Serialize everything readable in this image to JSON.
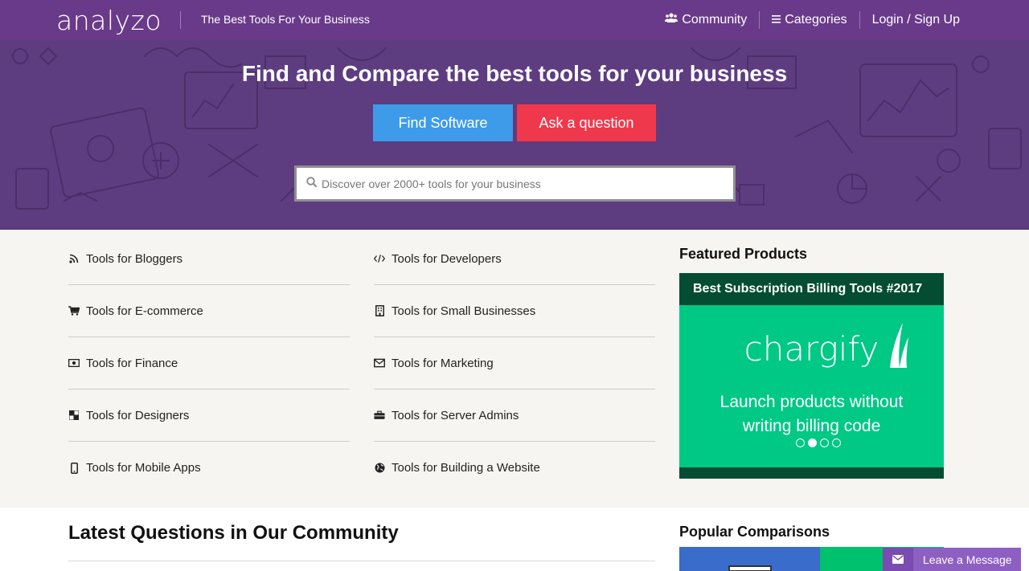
{
  "header": {
    "logo": "analyzo",
    "tagline": "The Best Tools For Your Business",
    "nav": [
      {
        "label": "Community",
        "icon": "users-icon"
      },
      {
        "label": "Categories",
        "icon": "menu-icon"
      },
      {
        "label": "Login / Sign Up"
      }
    ]
  },
  "hero": {
    "title": "Find and Compare the best tools for your business",
    "find_button": "Find Software",
    "ask_button": "Ask a question",
    "search_placeholder": "Discover over 2000+ tools for your business"
  },
  "categories": {
    "left": [
      {
        "label": "Tools for Bloggers",
        "icon": "rss-icon"
      },
      {
        "label": "Tools for E-commerce",
        "icon": "cart-icon"
      },
      {
        "label": "Tools for Finance",
        "icon": "money-icon"
      },
      {
        "label": "Tools for Designers",
        "icon": "palette-icon"
      },
      {
        "label": "Tools for Mobile Apps",
        "icon": "mobile-icon"
      }
    ],
    "right": [
      {
        "label": "Tools for Developers",
        "icon": "code-icon"
      },
      {
        "label": "Tools for Small Businesses",
        "icon": "building-icon"
      },
      {
        "label": "Tools for Marketing",
        "icon": "envelope-icon"
      },
      {
        "label": "Tools for Server Admins",
        "icon": "briefcase-icon"
      },
      {
        "label": "Tools for Building a Website",
        "icon": "globe-icon"
      }
    ]
  },
  "featured": {
    "title": "Featured Products",
    "card_heading": "Best Subscription Billing Tools #2017",
    "brand": "chargify",
    "tagline": "Launch products without writing billing code",
    "slide_count": 4,
    "active_slide": 2
  },
  "community": {
    "title": "Latest Questions in Our Community"
  },
  "comparisons": {
    "title": "Popular Comparisons"
  },
  "chat": {
    "label": "Leave a Message"
  },
  "colors": {
    "header_bg": "#6a3a8a",
    "hero_bg": "#5e3c80",
    "find_button": "#3d9be9",
    "ask_button": "#f0384c",
    "featured_green": "#00c885",
    "featured_dark": "#044d33",
    "chat_bg": "#8d5fc2"
  }
}
